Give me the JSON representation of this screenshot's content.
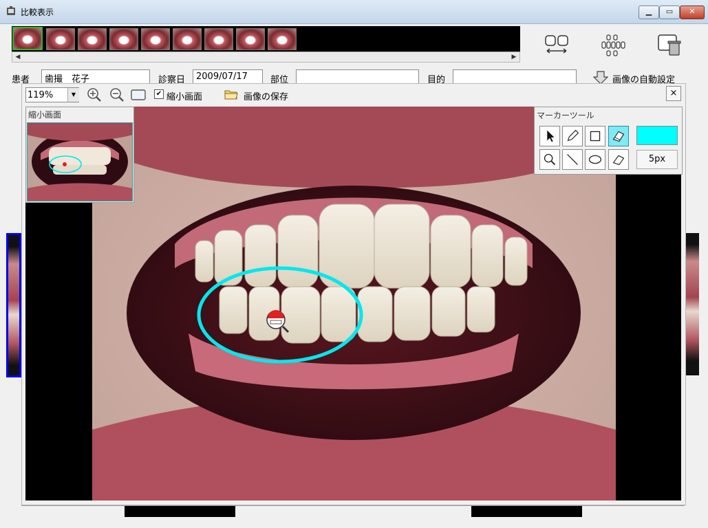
{
  "window": {
    "title": "比較表示"
  },
  "strip": {
    "thumbnail_count": 9,
    "selected_index": 0
  },
  "patient": {
    "patient_label": "患者",
    "patient_value": "歯撮　花子",
    "date_label": "診察日",
    "date_value": "2009/07/17",
    "part_label": "部位",
    "part_value": "",
    "purpose_label": "目的",
    "purpose_value": ""
  },
  "auto_setting": {
    "label": "画像の自動設定"
  },
  "viewer": {
    "zoom": "119%",
    "minimap_label": "縮小画面",
    "minimap_checked": true,
    "save_label": "画像の保存",
    "close_glyph": "×"
  },
  "minimap": {
    "title": "縮小画面"
  },
  "marker": {
    "title": "マーカーツール",
    "color": "#00ffff",
    "size": "5px",
    "active_tool": "highlighter"
  },
  "colors": {
    "accent": "#00ffff",
    "selected_thumb": "#2fb52f",
    "selected_frame": "#0000ee"
  }
}
